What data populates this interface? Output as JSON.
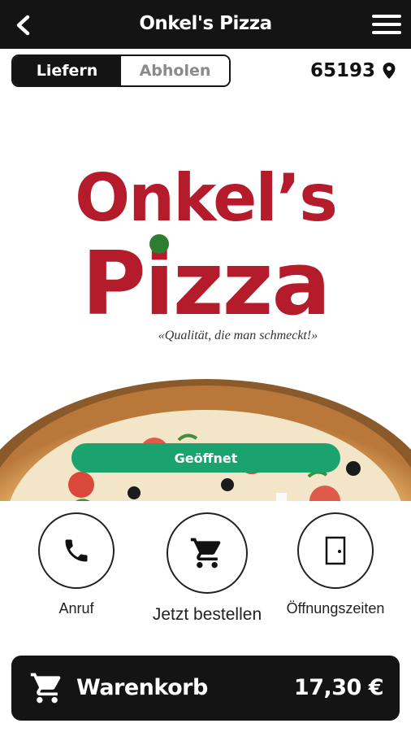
{
  "header": {
    "title": "Onkel's Pizza",
    "back_icon": "chevron-left-icon",
    "menu_icon": "hamburger-menu-icon"
  },
  "mode_toggle": {
    "options": [
      "Liefern",
      "Abholen"
    ],
    "selected": "Liefern"
  },
  "location": {
    "zip": "65193",
    "icon": "map-pin-icon"
  },
  "brand": {
    "line1": "Onkel’s",
    "line2": "Pizza",
    "slogan": "«Qualität, die man schmeckt!»",
    "colors": {
      "logo_red": "#b41c2c",
      "dot_green": "#2e7d32"
    }
  },
  "status": {
    "label": "Geöffnet",
    "color": "#1aa36f"
  },
  "actions": [
    {
      "label": "Anruf",
      "icon": "phone-icon"
    },
    {
      "label": "Jetzt bestellen",
      "icon": "shopping-cart-icon"
    },
    {
      "label": "Öffnungszeiten",
      "icon": "door-icon"
    }
  ],
  "cart": {
    "label": "Warenkorb",
    "total": "17,30 €",
    "icon": "shopping-cart-icon"
  },
  "colors": {
    "bar_dark": "#141414",
    "accent_green": "#1aa36f"
  }
}
